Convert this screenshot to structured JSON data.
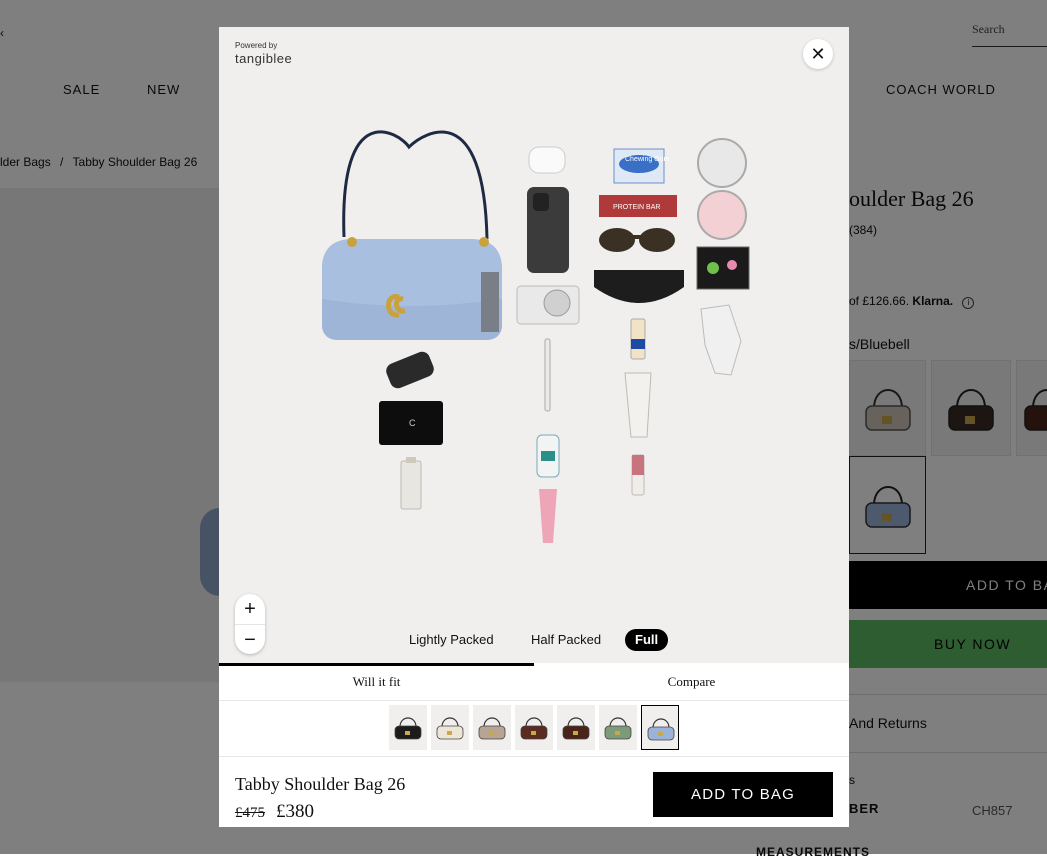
{
  "header": {
    "search_placeholder": "Search",
    "back_glyph": "‹",
    "nav": [
      "SALE",
      "NEW",
      "COACH WORLD"
    ]
  },
  "breadcrumb": [
    "lder Bags",
    "/",
    "Tabby Shoulder Bag 26"
  ],
  "pdp": {
    "title": "oulder Bag 26",
    "reviews": "(384)",
    "klarna_text": "of £126.66.",
    "klarna_brand": "Klarna.",
    "info_icon": "i",
    "color_name": "s/Bluebell",
    "add_to_bag": "ADD TO BAG",
    "buy_now": "BUY NOW",
    "returns": "And Returns",
    "s_label": "s",
    "ber_label": "BER",
    "style_code": "CH857",
    "measurements": "MEASUREMENTS"
  },
  "modal": {
    "powered_by": "Powered by",
    "brand": "tangiblee",
    "close_glyph": "✕",
    "zoom_in": "+",
    "zoom_out": "−",
    "packing_options": [
      "Lightly Packed",
      "Half Packed",
      "Full"
    ],
    "packing_selected": "Full",
    "tabs": [
      "Will it fit",
      "Compare"
    ],
    "active_tab": "Will it fit",
    "thumb_colors": [
      "#1b1b1b",
      "#ede6d6",
      "#b8a493",
      "#5a2b1e",
      "#4b2419",
      "#7d9b7a",
      "#9bb3d8"
    ],
    "selected_thumb_index": 6,
    "product_name": "Tabby Shoulder Bag 26",
    "price_old": "£475",
    "price_new": "£380",
    "add_to_bag": "ADD TO BAG",
    "items": {
      "gum_label": "Chewing Gum",
      "protein_label": "PROTEIN BAR"
    }
  },
  "colors": {
    "bag_blue": "#9bb3d8",
    "buy_now_green": "#5dbb63",
    "overlay": "rgba(0,0,0,0.5)"
  }
}
